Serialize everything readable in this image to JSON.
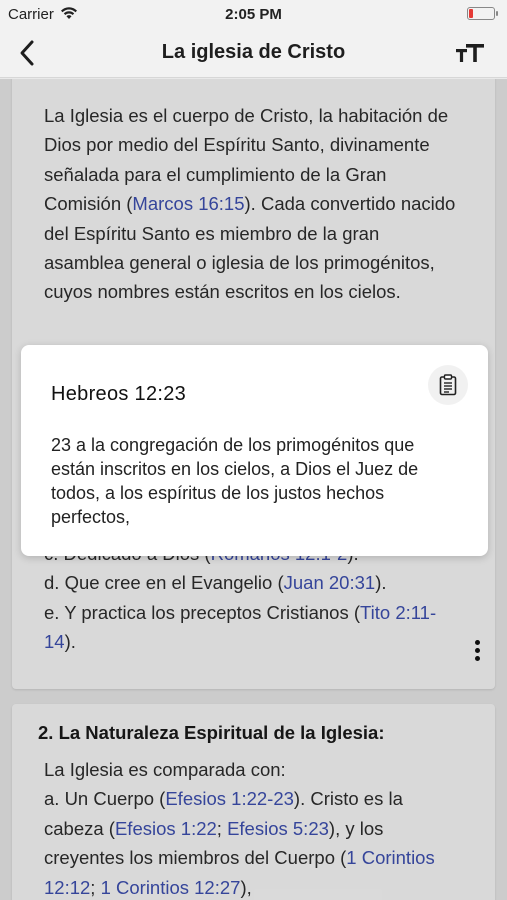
{
  "status_bar": {
    "carrier": "Carrier",
    "time": "2:05 PM",
    "battery_level": 0.15,
    "battery_color": "#e53935"
  },
  "nav": {
    "title": "La iglesia de Cristo",
    "back_icon": "chevron-left-icon",
    "font_icon": "text-size-icon"
  },
  "content": {
    "card1": {
      "paragraph": [
        {
          "text": "La Iglesia es el cuerpo de Cristo, la habitación de Dios por medio del Espíritu Santo, divinamente señalada para el cumplimiento de la Gran Comisión ("
        },
        {
          "text": "Marcos 16:15",
          "link": true
        },
        {
          "text": "). Cada convertido nacido del Espíritu Santo es miembro de la gran asamblea general o iglesia de los primogénitos, cuyos nombres están escritos en los cielos."
        }
      ],
      "list": [
        [
          {
            "text": "c. Dedicado a Dios ("
          },
          {
            "text": "Romanos 12:1-2",
            "link": true
          },
          {
            "text": ")."
          }
        ],
        [
          {
            "text": "d. Que cree en el Evangelio ("
          },
          {
            "text": "Juan 20:31",
            "link": true
          },
          {
            "text": ")."
          }
        ],
        [
          {
            "text": "e. Y practica los preceptos Cristianos ("
          },
          {
            "text": "Tito 2:11-14",
            "link": true
          },
          {
            "text": ")."
          }
        ]
      ]
    },
    "card2": {
      "section_title": "2. La Naturaleza Espiritual de la Iglesia:",
      "paragraph": [
        {
          "text": "La Iglesia es comparada con:"
        },
        {
          "text": "a. Un Cuerpo ("
        },
        {
          "text": "Efesios 1:22-23",
          "link": true
        },
        {
          "text": "). Cristo es la cabeza ("
        },
        {
          "text": "Efesios 1:22",
          "link": true
        },
        {
          "text": "; "
        },
        {
          "text": "Efesios 5:23",
          "link": true
        },
        {
          "text": "), y los creyentes los miembros del Cuerpo ("
        },
        {
          "text": "1 Corintios 12:12",
          "link": true
        },
        {
          "text": "; "
        },
        {
          "text": "1 Corintios 12:27",
          "link": true
        },
        {
          "text": "),"
        }
      ]
    }
  },
  "popup": {
    "title": "Hebreos 12:23",
    "text": "23 a la congregación de los primogénitos que están inscritos en los cielos, a Dios el Juez de todos, a los espíritus de los justos hechos perfectos,",
    "copy_icon": "clipboard-icon"
  },
  "colors": {
    "link": "#3d4fb0",
    "background": "#e9e9e9",
    "card": "#f8f8f8"
  }
}
